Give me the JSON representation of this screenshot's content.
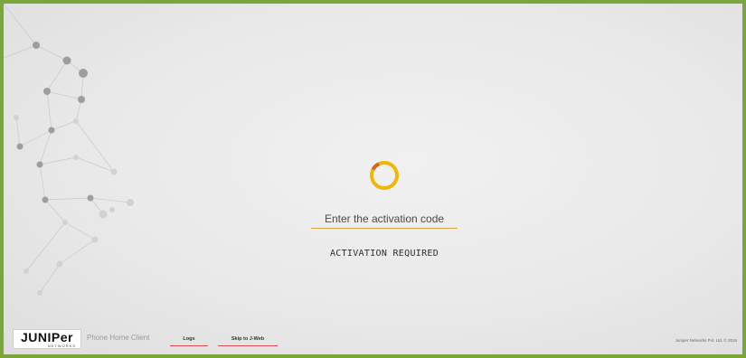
{
  "brand": {
    "logo_text": "JUNIPer",
    "logo_subtext": "NETWORKS",
    "app_name": "Phone Home Client"
  },
  "activation": {
    "code_placeholder": "Enter the activation code",
    "code_value": "",
    "status_text": "ACTIVATION  REQUIRED"
  },
  "footer": {
    "logs_label": "Logs",
    "jweb_label": "Skip to J-Web",
    "copyright": "Juniper Networks Pvt. Ltd. © 2016"
  },
  "colors": {
    "frame_border": "#7aa63c",
    "spinner_main": "#f2b705",
    "spinner_accent": "#d9622b",
    "input_underline": "#d9a441",
    "link_underline": "#e24a5a"
  },
  "icons": {
    "spinner": "loading-spinner-icon",
    "background": "network-nodes-graphic"
  }
}
